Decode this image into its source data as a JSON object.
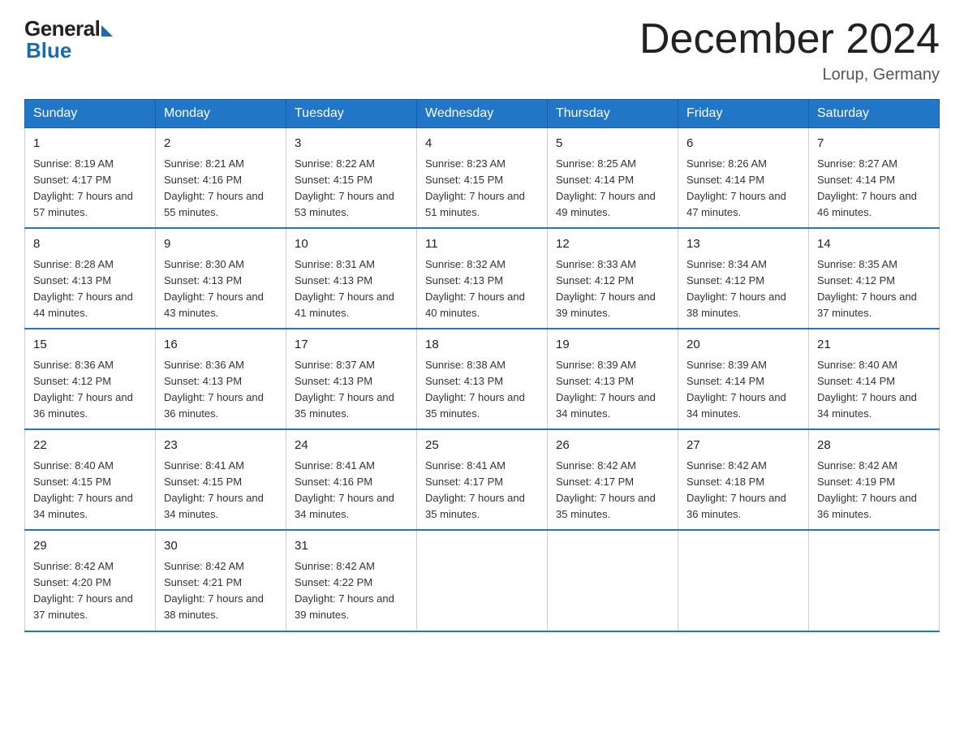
{
  "header": {
    "logo_general": "General",
    "logo_blue": "Blue",
    "title": "December 2024",
    "location": "Lorup, Germany"
  },
  "days_of_week": [
    "Sunday",
    "Monday",
    "Tuesday",
    "Wednesday",
    "Thursday",
    "Friday",
    "Saturday"
  ],
  "weeks": [
    [
      {
        "num": "1",
        "sunrise": "8:19 AM",
        "sunset": "4:17 PM",
        "daylight": "7 hours and 57 minutes."
      },
      {
        "num": "2",
        "sunrise": "8:21 AM",
        "sunset": "4:16 PM",
        "daylight": "7 hours and 55 minutes."
      },
      {
        "num": "3",
        "sunrise": "8:22 AM",
        "sunset": "4:15 PM",
        "daylight": "7 hours and 53 minutes."
      },
      {
        "num": "4",
        "sunrise": "8:23 AM",
        "sunset": "4:15 PM",
        "daylight": "7 hours and 51 minutes."
      },
      {
        "num": "5",
        "sunrise": "8:25 AM",
        "sunset": "4:14 PM",
        "daylight": "7 hours and 49 minutes."
      },
      {
        "num": "6",
        "sunrise": "8:26 AM",
        "sunset": "4:14 PM",
        "daylight": "7 hours and 47 minutes."
      },
      {
        "num": "7",
        "sunrise": "8:27 AM",
        "sunset": "4:14 PM",
        "daylight": "7 hours and 46 minutes."
      }
    ],
    [
      {
        "num": "8",
        "sunrise": "8:28 AM",
        "sunset": "4:13 PM",
        "daylight": "7 hours and 44 minutes."
      },
      {
        "num": "9",
        "sunrise": "8:30 AM",
        "sunset": "4:13 PM",
        "daylight": "7 hours and 43 minutes."
      },
      {
        "num": "10",
        "sunrise": "8:31 AM",
        "sunset": "4:13 PM",
        "daylight": "7 hours and 41 minutes."
      },
      {
        "num": "11",
        "sunrise": "8:32 AM",
        "sunset": "4:13 PM",
        "daylight": "7 hours and 40 minutes."
      },
      {
        "num": "12",
        "sunrise": "8:33 AM",
        "sunset": "4:12 PM",
        "daylight": "7 hours and 39 minutes."
      },
      {
        "num": "13",
        "sunrise": "8:34 AM",
        "sunset": "4:12 PM",
        "daylight": "7 hours and 38 minutes."
      },
      {
        "num": "14",
        "sunrise": "8:35 AM",
        "sunset": "4:12 PM",
        "daylight": "7 hours and 37 minutes."
      }
    ],
    [
      {
        "num": "15",
        "sunrise": "8:36 AM",
        "sunset": "4:12 PM",
        "daylight": "7 hours and 36 minutes."
      },
      {
        "num": "16",
        "sunrise": "8:36 AM",
        "sunset": "4:13 PM",
        "daylight": "7 hours and 36 minutes."
      },
      {
        "num": "17",
        "sunrise": "8:37 AM",
        "sunset": "4:13 PM",
        "daylight": "7 hours and 35 minutes."
      },
      {
        "num": "18",
        "sunrise": "8:38 AM",
        "sunset": "4:13 PM",
        "daylight": "7 hours and 35 minutes."
      },
      {
        "num": "19",
        "sunrise": "8:39 AM",
        "sunset": "4:13 PM",
        "daylight": "7 hours and 34 minutes."
      },
      {
        "num": "20",
        "sunrise": "8:39 AM",
        "sunset": "4:14 PM",
        "daylight": "7 hours and 34 minutes."
      },
      {
        "num": "21",
        "sunrise": "8:40 AM",
        "sunset": "4:14 PM",
        "daylight": "7 hours and 34 minutes."
      }
    ],
    [
      {
        "num": "22",
        "sunrise": "8:40 AM",
        "sunset": "4:15 PM",
        "daylight": "7 hours and 34 minutes."
      },
      {
        "num": "23",
        "sunrise": "8:41 AM",
        "sunset": "4:15 PM",
        "daylight": "7 hours and 34 minutes."
      },
      {
        "num": "24",
        "sunrise": "8:41 AM",
        "sunset": "4:16 PM",
        "daylight": "7 hours and 34 minutes."
      },
      {
        "num": "25",
        "sunrise": "8:41 AM",
        "sunset": "4:17 PM",
        "daylight": "7 hours and 35 minutes."
      },
      {
        "num": "26",
        "sunrise": "8:42 AM",
        "sunset": "4:17 PM",
        "daylight": "7 hours and 35 minutes."
      },
      {
        "num": "27",
        "sunrise": "8:42 AM",
        "sunset": "4:18 PM",
        "daylight": "7 hours and 36 minutes."
      },
      {
        "num": "28",
        "sunrise": "8:42 AM",
        "sunset": "4:19 PM",
        "daylight": "7 hours and 36 minutes."
      }
    ],
    [
      {
        "num": "29",
        "sunrise": "8:42 AM",
        "sunset": "4:20 PM",
        "daylight": "7 hours and 37 minutes."
      },
      {
        "num": "30",
        "sunrise": "8:42 AM",
        "sunset": "4:21 PM",
        "daylight": "7 hours and 38 minutes."
      },
      {
        "num": "31",
        "sunrise": "8:42 AM",
        "sunset": "4:22 PM",
        "daylight": "7 hours and 39 minutes."
      },
      null,
      null,
      null,
      null
    ]
  ]
}
